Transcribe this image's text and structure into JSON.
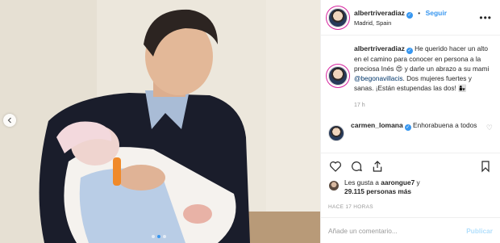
{
  "header": {
    "username": "albertriveradiaz",
    "verified_mark": "✓",
    "separator": "•",
    "follow_label": "Seguir",
    "location": "Madrid, Spain",
    "more_label": "•••"
  },
  "caption": {
    "username": "albertriveradiaz",
    "text_part1": " He querido hacer un alto en el camino para conocer en persona a la preciosa Inés 😍 y darle un abrazo a su mami ",
    "mention": "@begonavillacis",
    "text_part2": ". Dos mujeres fuertes y sanas. ¡Están estupendas las dos! 👩‍👧",
    "time": "17 h"
  },
  "comments": [
    {
      "username": "carmen_lomana",
      "verified_mark": "✓",
      "text": " Enhorabuena a todos"
    }
  ],
  "actions": {
    "like_icon": "heart-icon",
    "comment_icon": "comment-icon",
    "share_icon": "share-icon",
    "save_icon": "bookmark-icon"
  },
  "likes": {
    "prefix": "Les gusta a ",
    "user": "aarongue7",
    "middle": " y",
    "count": "29.115 personas más"
  },
  "time_ago": "HACE 17 HORAS",
  "add_comment": {
    "placeholder": "Añade un comentario...",
    "publish_label": "Publicar"
  },
  "carousel": {
    "prev_icon": "chevron-left-icon",
    "dots": 3,
    "active_dot": 1
  },
  "colors": {
    "accent": "#3897f0",
    "publish_disabled": "#b2dffc",
    "border": "#efefef"
  }
}
